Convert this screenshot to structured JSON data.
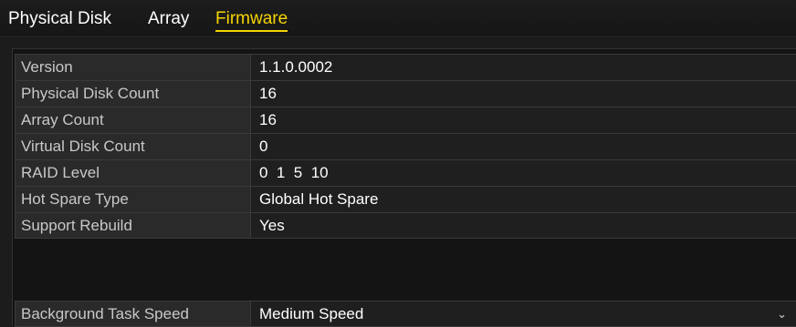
{
  "tabs": [
    {
      "label": "Physical Disk",
      "active": false
    },
    {
      "label": "Array",
      "active": false
    },
    {
      "label": "Firmware",
      "active": true
    }
  ],
  "active_tab_color": "#f6d500",
  "firmware": {
    "rows": [
      {
        "label": "Version",
        "value": "1.1.0.0002"
      },
      {
        "label": "Physical Disk Count",
        "value": "16"
      },
      {
        "label": "Array Count",
        "value": "16"
      },
      {
        "label": "Virtual Disk Count",
        "value": "0"
      },
      {
        "label": "RAID Level",
        "value": "0  1  5  10"
      },
      {
        "label": "Hot Spare Type",
        "value": "Global Hot Spare"
      },
      {
        "label": "Support Rebuild",
        "value": "Yes"
      }
    ]
  },
  "background_task": {
    "label": "Background Task Speed",
    "value": "Medium Speed",
    "icon": "chevron-down-icon"
  }
}
